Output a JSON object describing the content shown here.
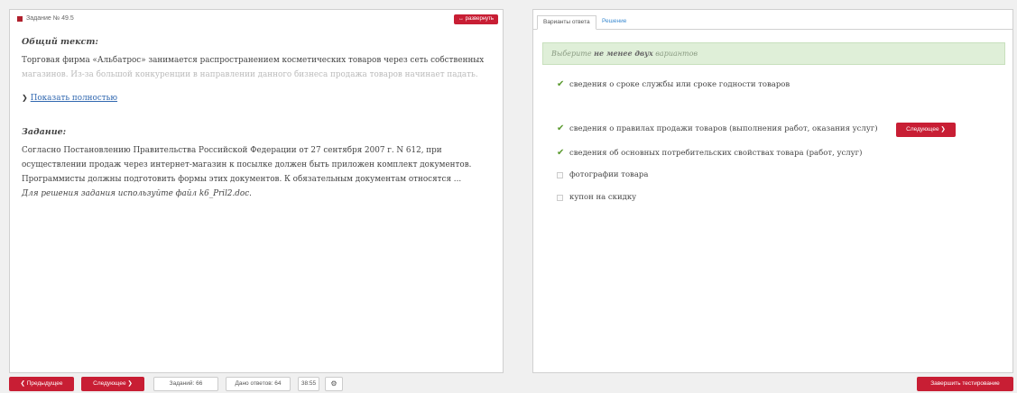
{
  "left": {
    "header_label": "Задание № 49.5",
    "expand_label": "↔ развернуть",
    "general_title": "Общий текст:",
    "general_text_line1": "Торговая фирма «Альбатрос» занимается распространением косметических товаров через сеть собственных",
    "general_text_line2": "магазинов. Из-за большой конкуренции в направлении данного бизнеса продажа товаров начинает падать.",
    "show_more": "Показать полностью",
    "task_title": "Задание:",
    "task_lines": [
      "Согласно Постановлению Правительства Российской Федерации от 27 сентября 2007 г. N 612, при",
      "осуществлении продаж через интернет-магазин к посылке должен быть приложен комплект документов.",
      "Программисты должны подготовить формы этих документов. К обязательным документам относятся ...",
      "Для решения задания используйте файл k6_Pril2.doc."
    ]
  },
  "right": {
    "tab_answers": "Варианты ответа",
    "tab_solution": "Решение",
    "hint_prefix": "Выберите ",
    "hint_bold": "не менее двух",
    "hint_suffix": " вариантов",
    "options": [
      {
        "label": "сведения о сроке службы или сроке годности товаров",
        "checked": true
      },
      {
        "label": "сведения о правилах продажи товаров (выполнения работ, оказания услуг)",
        "checked": true
      },
      {
        "label": "сведения об основных потребительских свойствах товара (работ, услуг)",
        "checked": true
      },
      {
        "label": "фотографии товара",
        "checked": false
      },
      {
        "label": "купон на скидку",
        "checked": false
      }
    ],
    "next_inline": "Следующее ❯"
  },
  "bottom": {
    "prev": "❮ Предыдущее",
    "next": "Следующее ❯",
    "tasks": "Заданий: 66",
    "answered": "Дано ответов: 64",
    "timer": "38:55",
    "settings_icon": "⚙",
    "finish": "Завершить тестирование"
  },
  "colors": {
    "accent_red": "#c81e34",
    "link_blue": "#3168b0",
    "check_green": "#5a9a2e",
    "hint_bg": "#dfefd8"
  }
}
